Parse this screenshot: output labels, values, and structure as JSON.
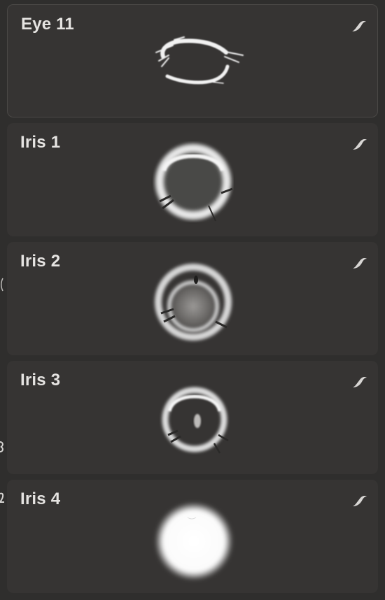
{
  "brushes": [
    {
      "name": "Eye 11",
      "icon": "brush-stroke-icon",
      "preview": "eye-outline-preview"
    },
    {
      "name": "Iris 1",
      "icon": "brush-stroke-icon",
      "preview": "iris-ring-preview"
    },
    {
      "name": "Iris 2",
      "icon": "brush-stroke-icon",
      "preview": "iris-double-ring-preview"
    },
    {
      "name": "Iris 3",
      "icon": "brush-stroke-icon",
      "preview": "iris-small-ring-preview"
    },
    {
      "name": "Iris 4",
      "icon": "brush-stroke-icon",
      "preview": "iris-soft-disc-preview"
    }
  ],
  "colors": {
    "background": "#2f2e2d",
    "card": "#363433",
    "label": "#e6e4e2"
  }
}
